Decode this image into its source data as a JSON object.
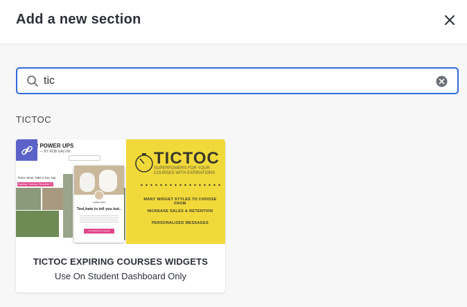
{
  "header": {
    "title": "Add a new section",
    "close_icon": "close-icon"
  },
  "search": {
    "value": "tic",
    "search_icon": "search-icon",
    "clear_icon": "clear-circle-icon"
  },
  "results": {
    "group_label": "TICTOC",
    "cards": [
      {
        "title": "TICTOC EXPIRING COURSES WIDGETS",
        "subtitle": "Use On Student Dashboard Only",
        "badge_icon": "link-icon",
        "thumbnail": {
          "left_header": "UPER POWER UPS",
          "left_byline": "— BY ROB GALVIN",
          "left_caption": "Tictoc Wow, Take a Sec Spi..",
          "left_date": "Expiring: Tuesday, December 7, 2021",
          "popup_name": "Ladies Nam",
          "popup_heading": "Teel,hate to tell you but..",
          "popup_button": "Yes! Extend my access",
          "brand": "TICTOC",
          "brand_tagline": "SUPERPOWERS FOR YOUR COURSES WITH EXPIRATIONS",
          "line1": "MANY WIDGET STYLES TO CHOOSE FROM",
          "line2": "INCREASE SALES & RETENTION",
          "line3": "PERSONALIZED MESSAGES"
        }
      }
    ]
  },
  "colors": {
    "accent": "#2d6ad9",
    "badge": "#5b63c9",
    "thumbnail_yellow": "#f2d93a"
  }
}
